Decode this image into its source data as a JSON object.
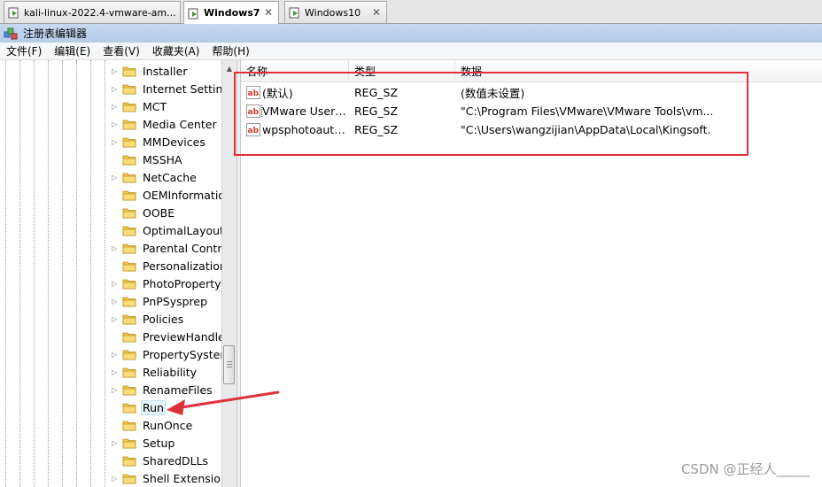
{
  "tabs": [
    {
      "label": "kali-linux-2022.4-vmware-am...",
      "active": false
    },
    {
      "label": "Windows7",
      "active": true
    },
    {
      "label": "Windows10",
      "active": false
    }
  ],
  "window": {
    "title": "注册表编辑器"
  },
  "menu": [
    "文件(F)",
    "编辑(E)",
    "查看(V)",
    "收藏夹(A)",
    "帮助(H)"
  ],
  "tree": {
    "items": [
      {
        "label": "Installer",
        "expandable": true
      },
      {
        "label": "Internet Settings",
        "expandable": true
      },
      {
        "label": "MCT",
        "expandable": true
      },
      {
        "label": "Media Center",
        "expandable": true
      },
      {
        "label": "MMDevices",
        "expandable": true
      },
      {
        "label": "MSSHA",
        "expandable": false
      },
      {
        "label": "NetCache",
        "expandable": true
      },
      {
        "label": "OEMInformation",
        "expandable": false
      },
      {
        "label": "OOBE",
        "expandable": false
      },
      {
        "label": "OptimalLayout",
        "expandable": false
      },
      {
        "label": "Parental Controls",
        "expandable": true
      },
      {
        "label": "Personalization",
        "expandable": false
      },
      {
        "label": "PhotoPropertyHandler",
        "expandable": true
      },
      {
        "label": "PnPSysprep",
        "expandable": true
      },
      {
        "label": "Policies",
        "expandable": true
      },
      {
        "label": "PreviewHandlers",
        "expandable": false
      },
      {
        "label": "PropertySystem",
        "expandable": true
      },
      {
        "label": "Reliability",
        "expandable": true
      },
      {
        "label": "RenameFiles",
        "expandable": true
      },
      {
        "label": "Run",
        "expandable": false,
        "selected": true
      },
      {
        "label": "RunOnce",
        "expandable": false
      },
      {
        "label": "Setup",
        "expandable": true
      },
      {
        "label": "SharedDLLs",
        "expandable": false
      },
      {
        "label": "Shell Extensions",
        "expandable": true
      }
    ]
  },
  "list": {
    "columns": [
      "名称",
      "类型",
      "数据"
    ],
    "rows": [
      {
        "name": "(默认)",
        "type": "REG_SZ",
        "data": "(数值未设置)"
      },
      {
        "name": "VMware User ...",
        "type": "REG_SZ",
        "data": "\"C:\\Program Files\\VMware\\VMware Tools\\vm...",
        "focused": true
      },
      {
        "name": "wpsphotoauto...",
        "type": "REG_SZ",
        "data": "\"C:\\Users\\wangzijian\\AppData\\Local\\Kingsoft..."
      }
    ]
  },
  "watermark": "CSDN @正经人_____",
  "colors": {
    "annotation": "#e0303a",
    "folder": "#f2c84b"
  }
}
